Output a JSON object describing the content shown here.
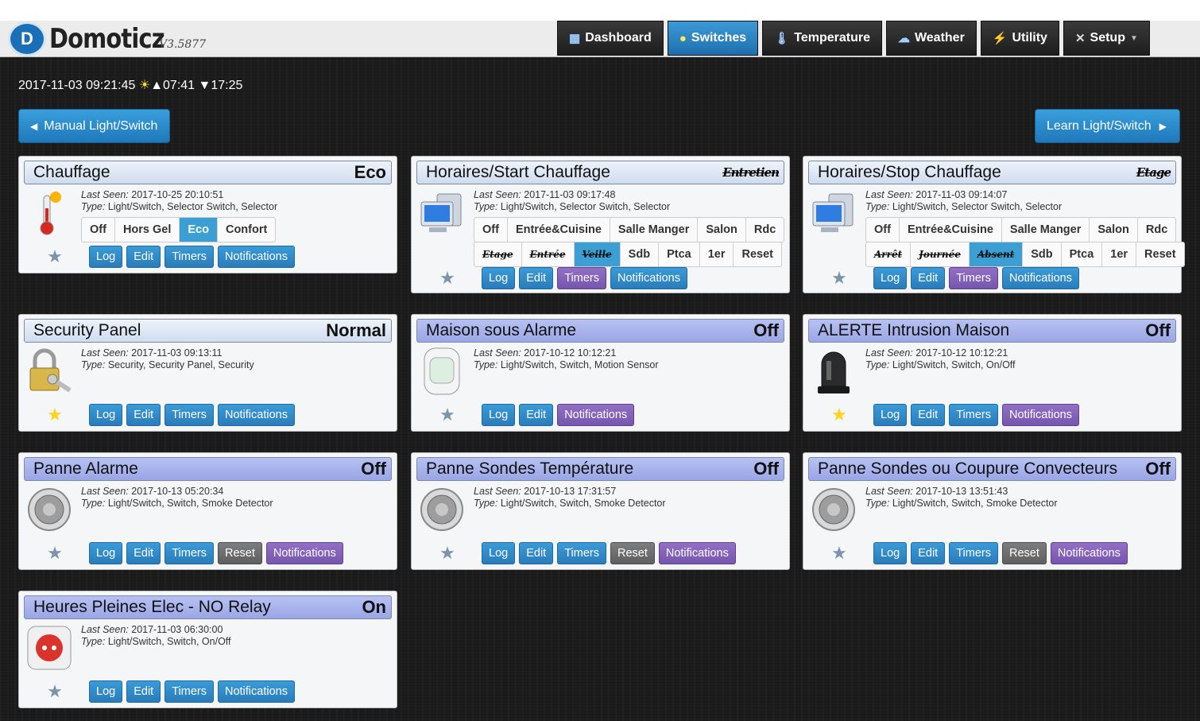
{
  "app": {
    "name": "Domoticz",
    "version": "V3.5877"
  },
  "nav": [
    {
      "label": "Dashboard",
      "icon": "dashboard-icon",
      "active": false
    },
    {
      "label": "Switches",
      "icon": "lightbulb-icon",
      "active": true
    },
    {
      "label": "Temperature",
      "icon": "thermometer-icon",
      "active": false
    },
    {
      "label": "Weather",
      "icon": "cloud-rain-icon",
      "active": false
    },
    {
      "label": "Utility",
      "icon": "lightning-icon",
      "active": false
    },
    {
      "label": "Setup",
      "icon": "tools-icon",
      "active": false
    }
  ],
  "status_bar": {
    "datetime": "2017-11-03 09:21:45",
    "sunrise": "▲07:41",
    "sunset": "▼17:25"
  },
  "buttons": {
    "manual": "Manual Light/Switch",
    "learn": "Learn Light/Switch"
  },
  "labels": {
    "last_seen": "Last Seen:",
    "type": "Type:"
  },
  "actions": {
    "log": "Log",
    "edit": "Edit",
    "timers": "Timers",
    "reset": "Reset",
    "notifications": "Notifications"
  },
  "devices": [
    {
      "name": "Chauffage",
      "status": "Eco",
      "last_seen": "2017-10-25 20:10:51",
      "type": "Light/Switch, Selector Switch, Selector",
      "selector": [
        "Off",
        "Hors Gel",
        "Eco",
        "Confort"
      ],
      "selector_active": 2,
      "favorite": false
    },
    {
      "name": "Horaires/Start Chauffage",
      "status": "Entretien",
      "last_seen": "2017-11-03 09:17:48",
      "type": "Light/Switch, Selector Switch, Selector",
      "selector_row1": [
        "Off",
        "Entrée&Cuisine",
        "Salle Manger",
        "Salon",
        "Rdc"
      ],
      "selector_row2": [
        "Etage",
        "Entrée",
        "Veille",
        "Sdb",
        "Ptca",
        "1er",
        "Reset"
      ],
      "selector_active_row2": 2,
      "favorite": false
    },
    {
      "name": "Horaires/Stop Chauffage",
      "status": "Etage",
      "last_seen": "2017-11-03 09:14:07",
      "type": "Light/Switch, Selector Switch, Selector",
      "selector_row1": [
        "Off",
        "Entrée&Cuisine",
        "Salle Manger",
        "Salon",
        "Rdc"
      ],
      "selector_row2": [
        "Arrêt",
        "Journée",
        "Absent",
        "Sdb",
        "Ptca",
        "1er",
        "Reset"
      ],
      "selector_active_row2": 2,
      "favorite": false
    },
    {
      "name": "Security Panel",
      "status": "Normal",
      "last_seen": "2017-11-03 09:13:11",
      "type": "Security, Security Panel, Security",
      "favorite": true
    },
    {
      "name": "Maison sous Alarme",
      "status": "Off",
      "last_seen": "2017-10-12 10:12:21",
      "type": "Light/Switch, Switch, Motion Sensor",
      "favorite": false
    },
    {
      "name": "ALERTE Intrusion Maison",
      "status": "Off",
      "last_seen": "2017-10-12 10:12:21",
      "type": "Light/Switch, Switch, On/Off",
      "favorite": true
    },
    {
      "name": "Panne Alarme",
      "status": "Off",
      "last_seen": "2017-10-13 05:20:34",
      "type": "Light/Switch, Switch, Smoke Detector",
      "favorite": false
    },
    {
      "name": "Panne Sondes Température",
      "status": "Off",
      "last_seen": "2017-10-13 17:31:57",
      "type": "Light/Switch, Switch, Smoke Detector",
      "favorite": false
    },
    {
      "name": "Panne Sondes ou Coupure Convecteurs",
      "status": "Off",
      "last_seen": "2017-10-13 13:51:43",
      "type": "Light/Switch, Switch, Smoke Detector",
      "favorite": false
    },
    {
      "name": "Heures Pleines Elec - NO Relay",
      "status": "On",
      "last_seen": "2017-11-03 06:30:00",
      "type": "Light/Switch, Switch, On/Off",
      "favorite": false
    }
  ]
}
